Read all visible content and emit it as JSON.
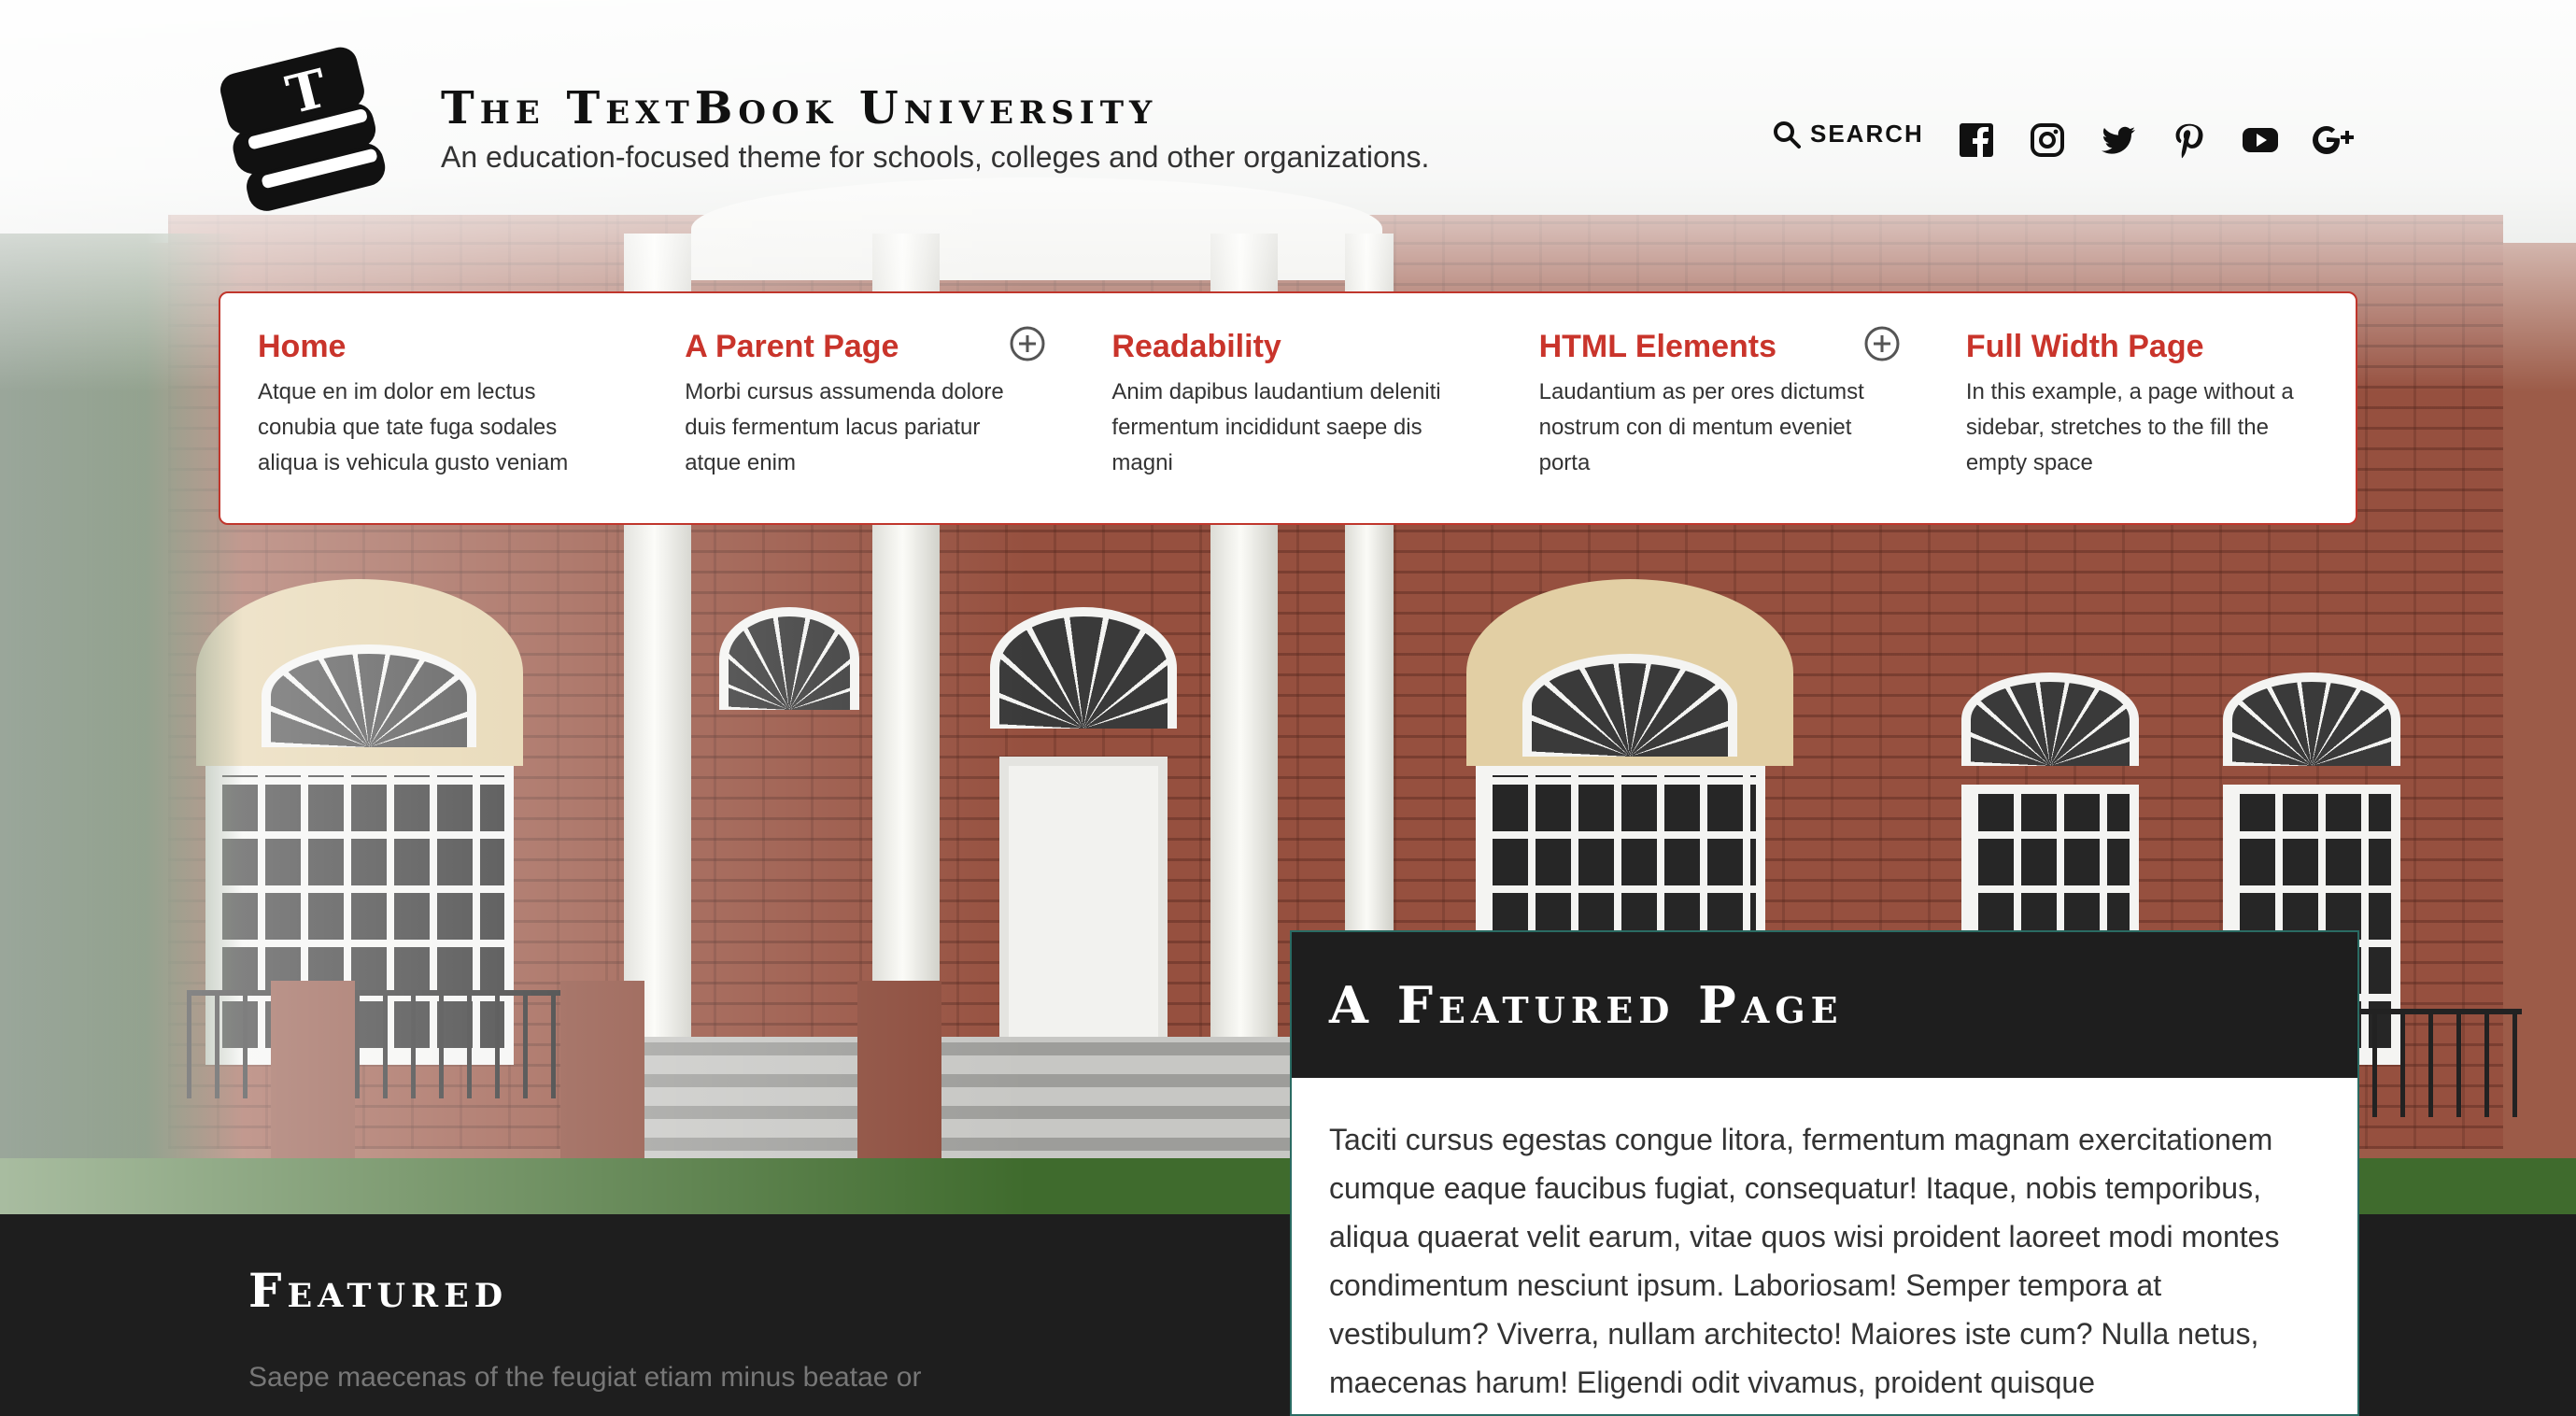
{
  "site": {
    "title": "The TextBook University",
    "tagline": "An education-focused theme for schools, colleges and other organizations.",
    "logo_letter": "T"
  },
  "header": {
    "search_label": "SEARCH",
    "social": [
      "facebook-icon",
      "instagram-icon",
      "twitter-icon",
      "pinterest-icon",
      "youtube-icon",
      "google-plus-icon"
    ]
  },
  "nav": {
    "items": [
      {
        "label": "Home",
        "desc": "Atque en im dolor em lectus conubia que tate fuga sodales aliqua is vehicula gusto veniam",
        "expandable": false
      },
      {
        "label": "A Parent Page",
        "desc": "Morbi cursus assumenda dolore duis fermentum lacus pariatur atque enim",
        "expandable": true
      },
      {
        "label": "Readability",
        "desc": "Anim dapibus laudantium deleniti fermentum incididunt saepe dis magni",
        "expandable": false
      },
      {
        "label": "HTML Elements",
        "desc": "Laudantium as per ores dictumst nostrum con di mentum eveniet porta",
        "expandable": true
      },
      {
        "label": "Full Width Page",
        "desc": "In this example, a page without a sidebar, stretches to the fill the empty space",
        "expandable": false
      }
    ]
  },
  "featured": {
    "heading": "Featured",
    "text": "Saepe maecenas of the feugiat etiam minus beatae or"
  },
  "featured_page": {
    "title": "A Featured Page",
    "body": "Taciti cursus egestas congue litora, fermentum magnam exercitationem cumque eaque faucibus fugiat, consequatur! Itaque, nobis temporibus, aliqua quaerat velit earum, vitae quos wisi proident laoreet modi montes condimentum nesciunt ipsum. Laboriosam! Semper tempora at vestibulum? Viverra, nullam architecto! Maiores iste cum? Nulla netus, maecenas harum! Eligendi odit vivamus, proident quisque"
  },
  "colors": {
    "accent": "#c9342b",
    "dark": "#1e1e1e",
    "card_border": "#2a6b63"
  }
}
